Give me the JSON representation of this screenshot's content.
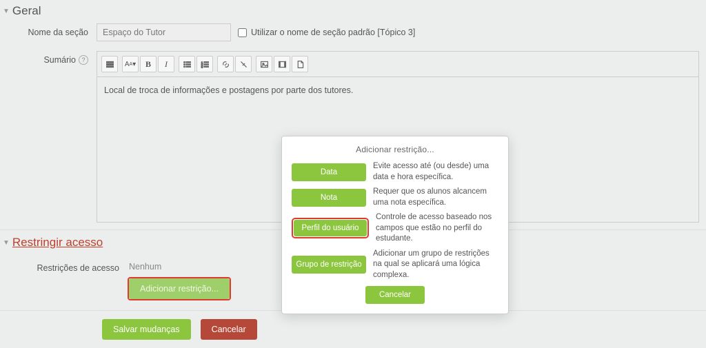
{
  "general": {
    "title": "Geral",
    "section_name_label": "Nome da seção",
    "section_name_value": "Espaço do Tutor",
    "use_default_label": "Utilizar o nome de seção padrão [Tópico 3]",
    "summary_label": "Sumário",
    "summary_content": "Local de troca de informações e postagens por parte dos tutores."
  },
  "restrict": {
    "title": "Restringir acesso",
    "restrictions_label": "Restrições de acesso",
    "none_text": "Nenhum",
    "add_button": "Adicionar restrição..."
  },
  "footer": {
    "save": "Salvar mudanças",
    "cancel": "Cancelar"
  },
  "modal": {
    "title": "Adicionar restrição...",
    "options": [
      {
        "label": "Data",
        "desc": "Evite acesso até (ou desde) uma data e hora específica."
      },
      {
        "label": "Nota",
        "desc": "Requer que os alunos alcancem uma nota específica."
      },
      {
        "label": "Perfil do usuário",
        "desc": "Controle de acesso baseado nos campos que estão no perfil do estudante."
      },
      {
        "label": "Grupo de restrição",
        "desc": "Adicionar um grupo de restrições na qual se aplicará uma lógica complexa."
      }
    ],
    "cancel": "Cancelar"
  }
}
